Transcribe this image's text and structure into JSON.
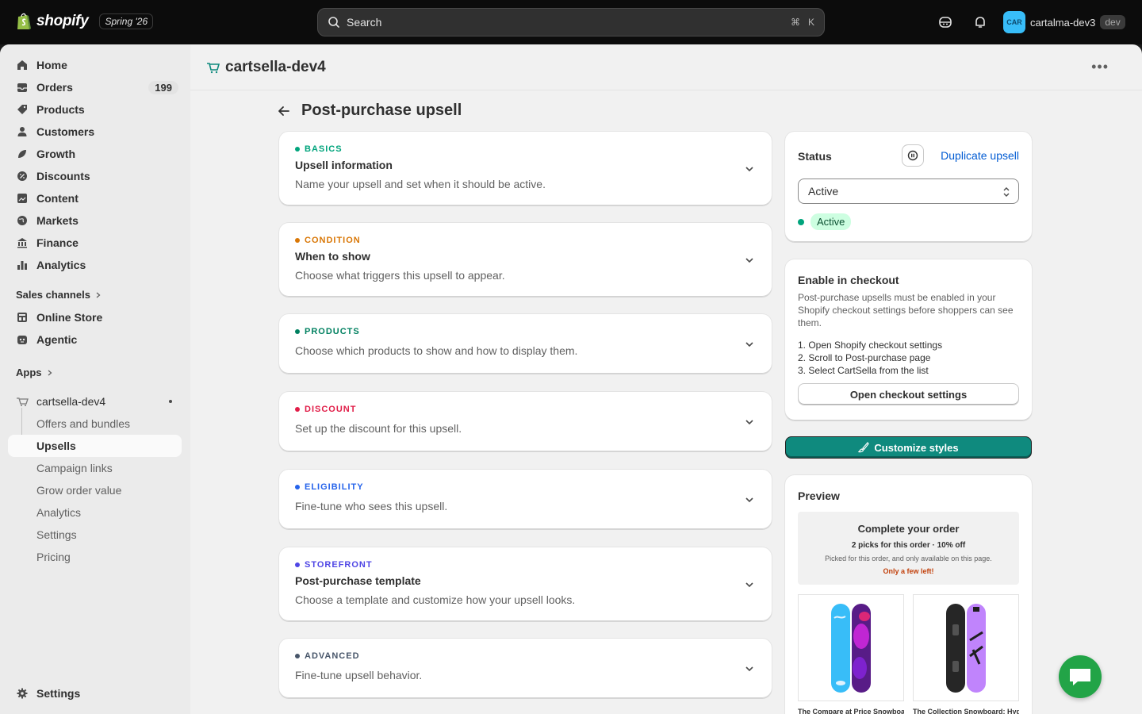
{
  "topbar": {
    "brand": "shopify",
    "edition": "Spring '26",
    "search_placeholder": "Search",
    "search_shortcut_cmd": "⌘",
    "search_shortcut_key": "K",
    "user_initials": "CAR",
    "user_name": "cartalma-dev3",
    "user_badge": "dev"
  },
  "sidebar": {
    "items": [
      {
        "label": "Home",
        "icon": "home-icon"
      },
      {
        "label": "Orders",
        "icon": "orders-icon",
        "count": "199"
      },
      {
        "label": "Products",
        "icon": "tag-icon"
      },
      {
        "label": "Customers",
        "icon": "person-icon"
      },
      {
        "label": "Growth",
        "icon": "growth-icon"
      },
      {
        "label": "Discounts",
        "icon": "discount-icon"
      },
      {
        "label": "Content",
        "icon": "content-icon"
      },
      {
        "label": "Markets",
        "icon": "globe-icon"
      },
      {
        "label": "Finance",
        "icon": "bank-icon"
      },
      {
        "label": "Analytics",
        "icon": "bar-chart-icon"
      }
    ],
    "sales_channels_heading": "Sales channels",
    "channels": [
      {
        "label": "Online Store",
        "icon": "store-icon"
      },
      {
        "label": "Agentic",
        "icon": "agent-icon"
      }
    ],
    "apps_heading": "Apps",
    "app_name": "cartsella-dev4",
    "app_subitems": [
      "Offers and bundles",
      "Upsells",
      "Campaign links",
      "Grow order value",
      "Analytics",
      "Settings",
      "Pricing"
    ],
    "active_subitem": "Upsells",
    "settings_label": "Settings"
  },
  "app_header": {
    "title": "cartsella-dev4"
  },
  "page": {
    "title": "Post-purchase upsell"
  },
  "sections": [
    {
      "tag": "BASICS",
      "color": "#00a47c",
      "title": "Upsell information",
      "desc": "Name your upsell and set when it should be active."
    },
    {
      "tag": "CONDITION",
      "color": "#d97706",
      "title": "When to show",
      "desc": "Choose what triggers this upsell to appear."
    },
    {
      "tag": "PRODUCTS",
      "color": "#008060",
      "title": "",
      "desc": "Choose which products to show and how to display them."
    },
    {
      "tag": "DISCOUNT",
      "color": "#e11d48",
      "title": "",
      "desc": "Set up the discount for this upsell."
    },
    {
      "tag": "ELIGIBILITY",
      "color": "#2563eb",
      "title": "",
      "desc": "Fine-tune who sees this upsell."
    },
    {
      "tag": "STOREFRONT",
      "color": "#4f46e5",
      "title": "Post-purchase template",
      "desc": "Choose a template and customize how your upsell looks."
    },
    {
      "tag": "ADVANCED",
      "color": "#475569",
      "title": "",
      "desc": "Fine-tune upsell behavior."
    }
  ],
  "status_card": {
    "heading": "Status",
    "duplicate_label": "Duplicate upsell",
    "select_value": "Active",
    "badge": "Active"
  },
  "checkout_card": {
    "heading": "Enable in checkout",
    "body": "Post-purchase upsells must be enabled in your Shopify checkout settings before shoppers can see them.",
    "steps": [
      "1. Open Shopify checkout settings",
      "2. Scroll to Post-purchase page",
      "3. Select CartSella from the list"
    ],
    "button": "Open checkout settings"
  },
  "customize_button": "Customize styles",
  "preview": {
    "heading": "Preview",
    "title": "Complete your order",
    "subtitle": "2 picks for this order · 10% off",
    "note": "Picked for this order, and only available on this page.",
    "urgency": "Only a few left!",
    "products": [
      "The Compare at Price Snowboard",
      "The Collection Snowboard: Hydrogen"
    ]
  }
}
